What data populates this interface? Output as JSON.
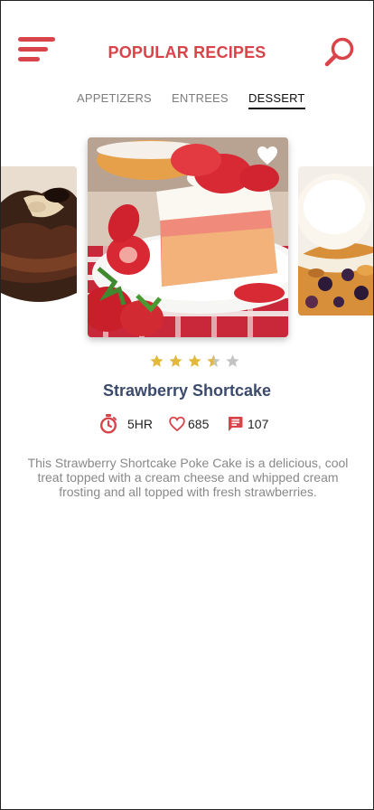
{
  "header": {
    "title": "POPULAR RECIPES",
    "menu_icon": "hamburger-menu-icon",
    "search_icon": "search-icon"
  },
  "tabs": [
    {
      "label": "APPETIZERS",
      "active": false
    },
    {
      "label": "ENTREES",
      "active": false
    },
    {
      "label": "DESSERT",
      "active": true
    }
  ],
  "carousel": {
    "prev_image": "chocolate-brownie-dessert-image",
    "current_image": "strawberry-shortcake-image",
    "next_image": "fruit-cobbler-with-ice-cream-image",
    "favorite_icon": "heart-icon"
  },
  "recipe": {
    "title": "Strawberry Shortcake",
    "rating": 3.5,
    "rating_max": 5,
    "time": "5HR",
    "likes": "685",
    "comments": "107",
    "description": "This Strawberry Shortcake Poke Cake is a delicious, cool treat topped with a cream cheese and whipped cream frosting and all topped with fresh strawberries."
  },
  "colors": {
    "accent": "#d9444a",
    "title": "#3c4b6c",
    "star_filled": "#e2b93b",
    "star_empty": "#c4c4c4"
  }
}
